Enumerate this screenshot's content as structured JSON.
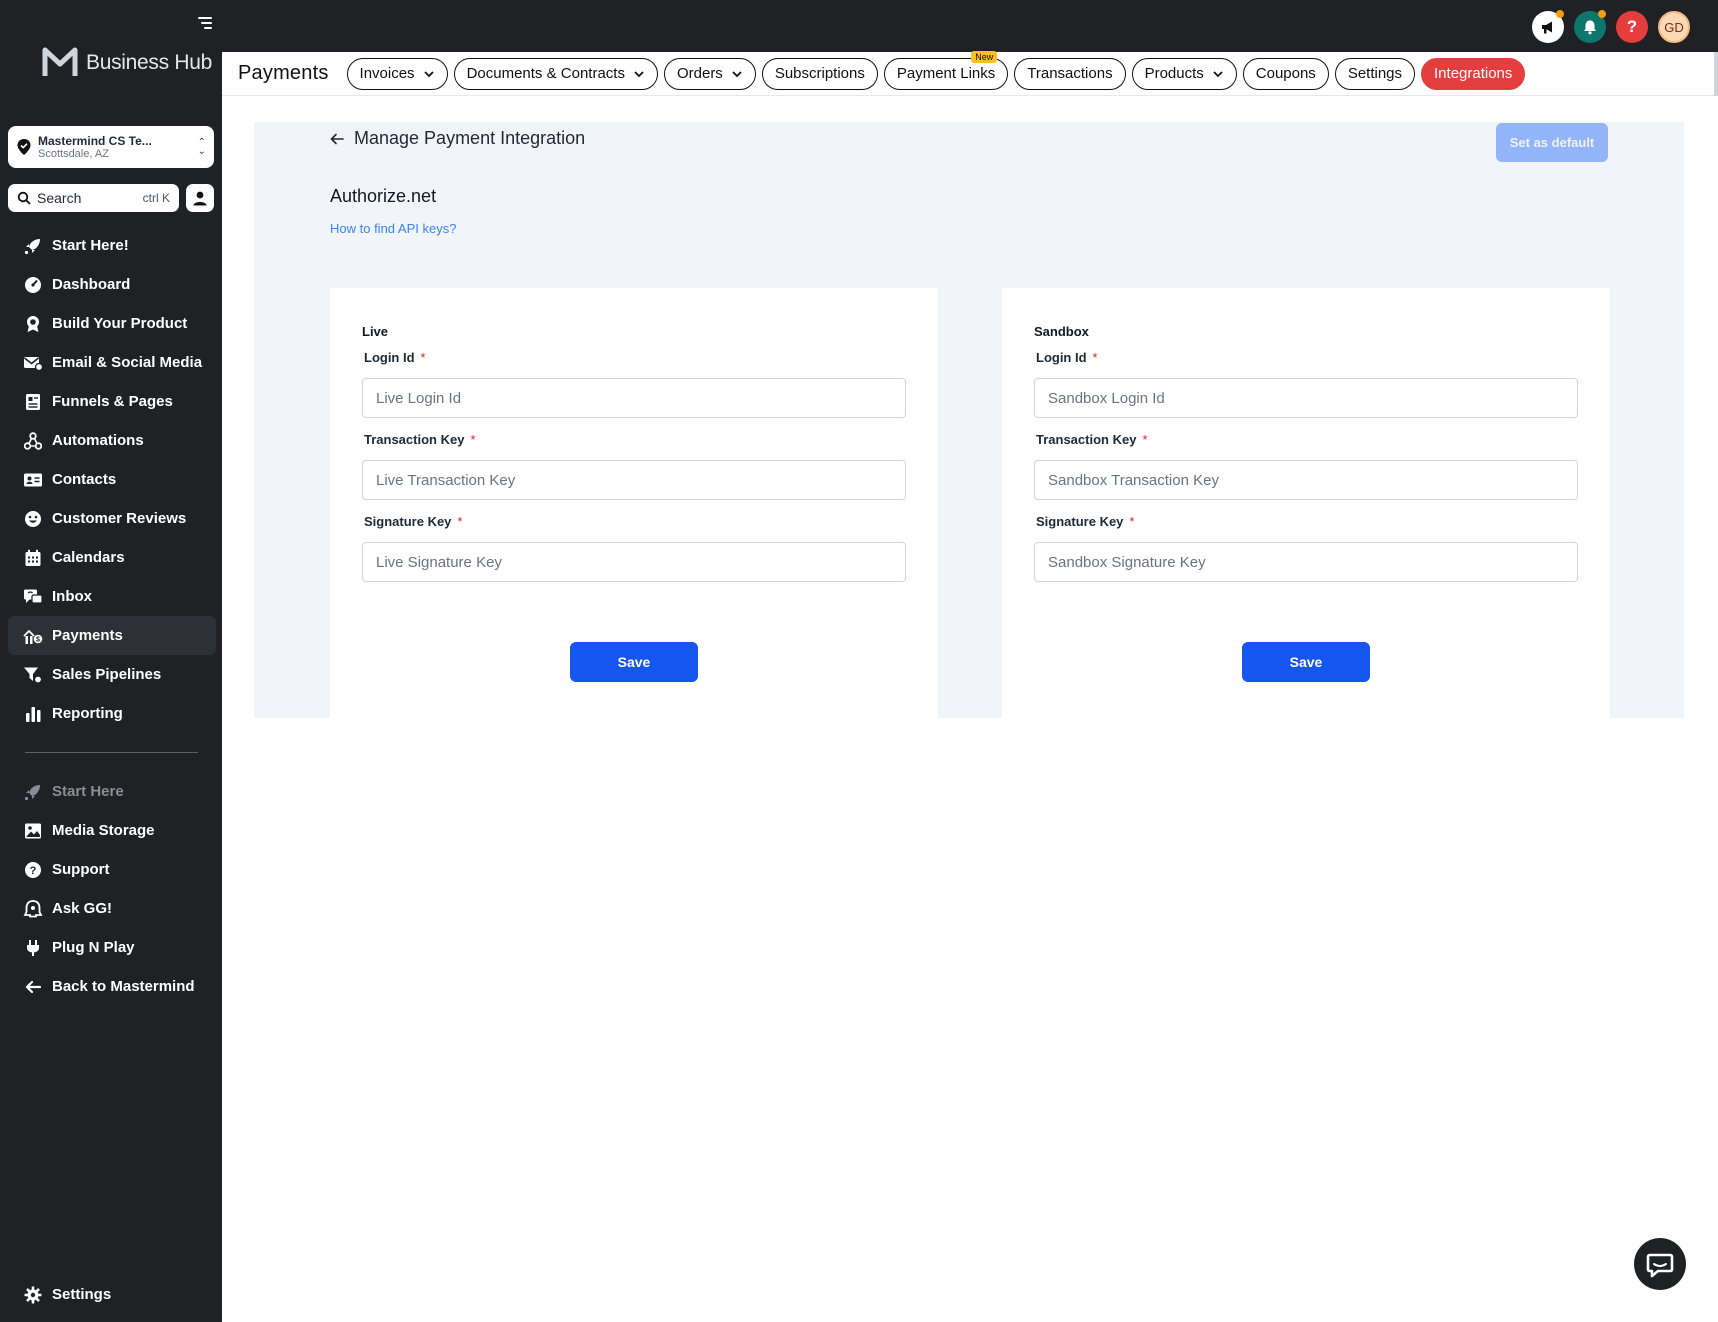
{
  "sidebar": {
    "brand": "Business Hub",
    "location": {
      "name": "Mastermind CS Te...",
      "city": "Scottsdale, AZ"
    },
    "search": {
      "label": "Search",
      "shortcut": "ctrl K"
    },
    "items": [
      {
        "label": "Start Here!",
        "icon": "rocket-icon"
      },
      {
        "label": "Dashboard",
        "icon": "gauge-icon"
      },
      {
        "label": "Build Your Product",
        "icon": "award-icon"
      },
      {
        "label": "Email & Social Media",
        "icon": "mail-icon"
      },
      {
        "label": "Funnels & Pages",
        "icon": "pages-icon"
      },
      {
        "label": "Automations",
        "icon": "workflow-icon"
      },
      {
        "label": "Contacts",
        "icon": "contact-card-icon"
      },
      {
        "label": "Customer Reviews",
        "icon": "smile-icon"
      },
      {
        "label": "Calendars",
        "icon": "calendar-icon"
      },
      {
        "label": "Inbox",
        "icon": "chat-icon"
      },
      {
        "label": "Payments",
        "icon": "payments-icon"
      },
      {
        "label": "Sales Pipelines",
        "icon": "funnel-icon"
      },
      {
        "label": "Reporting",
        "icon": "bar-chart-icon"
      }
    ],
    "secondary": [
      {
        "label": "Start Here",
        "icon": "rocket-icon"
      },
      {
        "label": "Media Storage",
        "icon": "image-icon"
      },
      {
        "label": "Support",
        "icon": "help-icon"
      },
      {
        "label": "Ask GG!",
        "icon": "assistant-icon"
      },
      {
        "label": "Plug N Play",
        "icon": "plug-icon"
      },
      {
        "label": "Back to Mastermind",
        "icon": "arrow-left-icon"
      }
    ],
    "settings_label": "Settings"
  },
  "topbar": {
    "avatar_initials": "GD"
  },
  "header": {
    "title": "Payments",
    "tabs": [
      {
        "label": "Invoices"
      },
      {
        "label": "Documents & Contracts"
      },
      {
        "label": "Orders"
      },
      {
        "label": "Subscriptions"
      },
      {
        "label": "Payment Links",
        "badge": "New"
      },
      {
        "label": "Transactions"
      },
      {
        "label": "Products"
      },
      {
        "label": "Coupons"
      },
      {
        "label": "Settings"
      },
      {
        "label": "Integrations"
      }
    ]
  },
  "main": {
    "back_label": "Manage Payment Integration",
    "set_default_label": "Set as default",
    "provider": "Authorize.net",
    "api_link": "How to find API keys?",
    "live": {
      "title": "Live",
      "fields": [
        {
          "label": "Login Id",
          "placeholder": "Live Login Id"
        },
        {
          "label": "Transaction Key",
          "placeholder": "Live Transaction Key"
        },
        {
          "label": "Signature Key",
          "placeholder": "Live Signature Key"
        }
      ],
      "save_label": "Save"
    },
    "sandbox": {
      "title": "Sandbox",
      "fields": [
        {
          "label": "Login Id",
          "placeholder": "Sandbox Login Id"
        },
        {
          "label": "Transaction Key",
          "placeholder": "Sandbox Transaction Key"
        },
        {
          "label": "Signature Key",
          "placeholder": "Sandbox Signature Key"
        }
      ],
      "save_label": "Save"
    },
    "required_mark": "*"
  },
  "colors": {
    "sidebar_bg": "#1f2124",
    "primary": "#1556f0",
    "danger": "#e53e3e",
    "panel_bg": "#f1f5f9"
  }
}
